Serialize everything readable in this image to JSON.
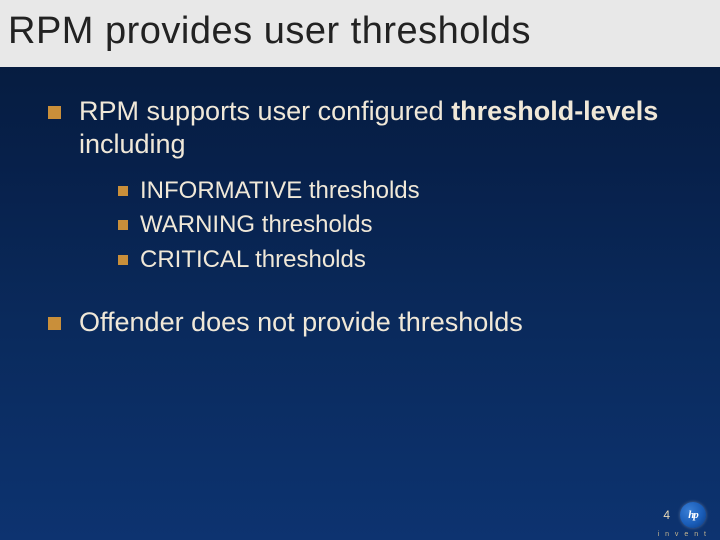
{
  "title": "RPM provides user thresholds",
  "bullets": {
    "b1": {
      "pre": "RPM supports user configured ",
      "bold": "threshold-levels",
      "post": " including"
    },
    "sub": {
      "s1": "INFORMATIVE thresholds",
      "s2": "WARNING thresholds",
      "s3": "CRITICAL thresholds"
    },
    "b2": "Offender does not provide thresholds"
  },
  "page_number": "4",
  "logo_text": "hp",
  "tagline": "i n v e n t"
}
